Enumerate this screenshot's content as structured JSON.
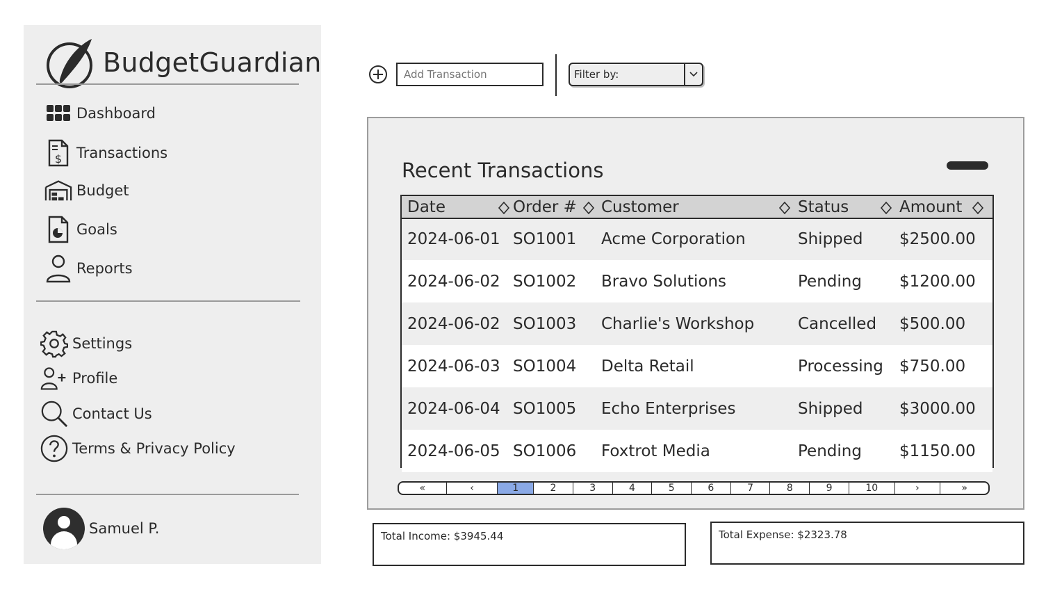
{
  "app": {
    "name": "BudgetGuardian"
  },
  "nav_primary": [
    {
      "label": "Dashboard",
      "icon": "grid-icon"
    },
    {
      "label": "Transactions",
      "icon": "receipt-dollar-icon"
    },
    {
      "label": "Budget",
      "icon": "warehouse-icon"
    },
    {
      "label": "Goals",
      "icon": "chart-document-icon"
    },
    {
      "label": "Reports",
      "icon": "person-icon"
    }
  ],
  "nav_secondary": [
    {
      "label": "Settings",
      "icon": "gear-icon"
    },
    {
      "label": "Profile",
      "icon": "add-user-icon"
    },
    {
      "label": "Contact Us",
      "icon": "search-icon"
    },
    {
      "label": "Terms & Privacy Policy",
      "icon": "help-icon"
    }
  ],
  "user": {
    "name": "Samuel P."
  },
  "toolbar": {
    "add_placeholder": "Add Transaction",
    "filter_label": "Filter by:"
  },
  "transactions": {
    "title": "Recent Transactions",
    "columns": [
      "Date",
      "Order #",
      "Customer",
      "Status",
      "Amount"
    ],
    "rows": [
      [
        "2024-06-01",
        "SO1001",
        "Acme Corporation",
        "Shipped",
        "$2500.00"
      ],
      [
        "2024-06-02",
        "SO1002",
        "Bravo Solutions",
        "Pending",
        "$1200.00"
      ],
      [
        "2024-06-02",
        "SO1003",
        "Charlie's Workshop",
        "Cancelled",
        "$500.00"
      ],
      [
        "2024-06-03",
        "SO1004",
        "Delta Retail",
        "Processing",
        "$750.00"
      ],
      [
        "2024-06-04",
        "SO1005",
        "Echo Enterprises",
        "Shipped",
        "$3000.00"
      ],
      [
        "2024-06-05",
        "SO1006",
        "Foxtrot Media",
        "Pending",
        "$1150.00"
      ]
    ]
  },
  "pagination": {
    "first": "«",
    "prev": "‹",
    "next": "›",
    "last": "»",
    "pages": [
      "1",
      "2",
      "3",
      "4",
      "5",
      "6",
      "7",
      "8",
      "9",
      "10"
    ],
    "current": "1"
  },
  "summary": {
    "income": "Total Income: $3945.44",
    "expense": "Total Expense: $2323.78"
  },
  "colors": {
    "sidebar_bg": "#eeeeee",
    "active_page": "#8aa9e6",
    "header_bg": "#d3d3d3"
  }
}
